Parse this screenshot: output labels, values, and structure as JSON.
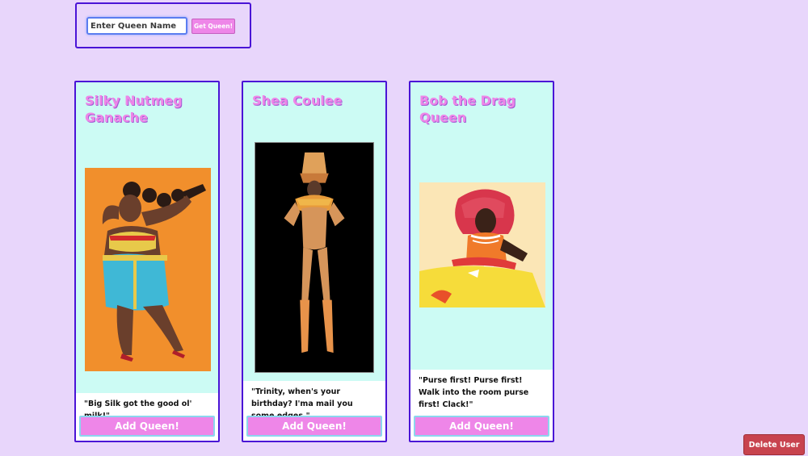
{
  "search": {
    "placeholder": "Enter Queen Name",
    "value": "",
    "button_label": "Get Queen!"
  },
  "queens": [
    {
      "name": "Silky Nutmeg Ganache",
      "quote": "\"Big Silk got the good ol' milk!\"",
      "add_label": "Add Queen!",
      "photo_icon": "queen-photo-orange-backdrop"
    },
    {
      "name": "Shea Coulee",
      "quote": "\"Trinity, when's your birthday? I'ma mail you some edges.\"",
      "add_label": "Add Queen!",
      "photo_icon": "queen-photo-black-backdrop"
    },
    {
      "name": "Bob the Drag Queen",
      "quote": "\"Purse first! Purse first! Walk into the room purse first! Clack!\"",
      "add_label": "Add Queen!",
      "photo_icon": "queen-photo-cream-backdrop"
    }
  ],
  "footer": {
    "delete_label": "Delete User"
  },
  "colors": {
    "background": "#e8d6fb",
    "card_background": "#ccfbf4",
    "border": "#4a14d6",
    "accent_pink": "#ee86e8",
    "delete_red": "#c8434e"
  }
}
